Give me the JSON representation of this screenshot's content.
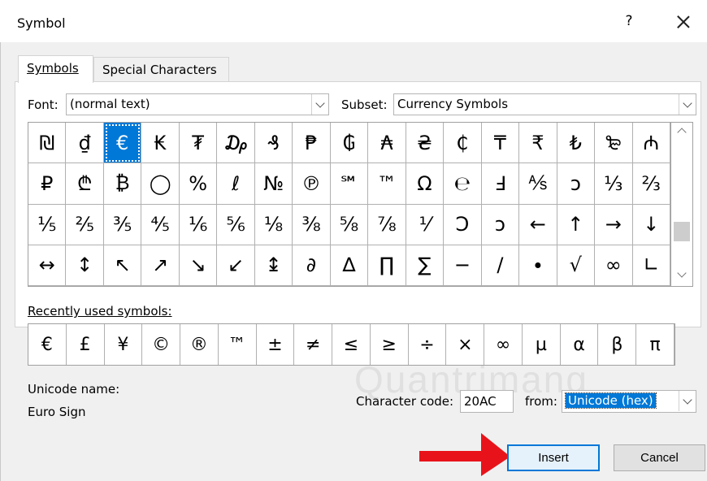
{
  "window": {
    "title": "Symbol",
    "help": "?"
  },
  "tabs": [
    {
      "label": "Symbols",
      "active": true
    },
    {
      "label": "Special Characters",
      "active": false
    }
  ],
  "font": {
    "label": "Font:",
    "value": "(normal text)"
  },
  "subset": {
    "label": "Subset:",
    "value": "Currency Symbols"
  },
  "symbols": [
    "₪",
    "₫",
    "€",
    "₭",
    "₮",
    "₯",
    "₰",
    "₱",
    "₲",
    "₳",
    "₴",
    "₵",
    "₸",
    "₹",
    "₺",
    "₻",
    "₼",
    "₽",
    "₾",
    "₿",
    "◯",
    "%",
    "ℓ",
    "№",
    "℗",
    "℠",
    "™",
    "Ω",
    "℮",
    "Ⅎ",
    "⅍",
    "ↄ",
    "⅓",
    "⅔",
    "⅕",
    "⅖",
    "⅗",
    "⅘",
    "⅙",
    "⅚",
    "⅛",
    "⅜",
    "⅝",
    "⅞",
    "⅟",
    "Ↄ",
    "ↄ",
    "←",
    "↑",
    "→",
    "↓",
    "↔",
    "↕",
    "↖",
    "↗",
    "↘",
    "↙",
    "↨",
    "∂",
    "∆",
    "∏",
    "∑",
    "−",
    "∕",
    "∙",
    "√",
    "∞",
    "∟"
  ],
  "selected_index": 2,
  "recent": {
    "label": "Recently used symbols:",
    "items": [
      "€",
      "£",
      "¥",
      "©",
      "®",
      "™",
      "±",
      "≠",
      "≤",
      "≥",
      "÷",
      "×",
      "∞",
      "µ",
      "α",
      "β",
      "π"
    ]
  },
  "unicode": {
    "label": "Unicode name:",
    "value": "Euro Sign"
  },
  "char_code": {
    "label": "Character code:",
    "value": "20AC"
  },
  "from": {
    "label": "from:",
    "value": "Unicode (hex)"
  },
  "buttons": {
    "insert": "Insert",
    "cancel": "Cancel"
  },
  "watermark": "Quantrimang",
  "colors": {
    "selection": "#0078d7",
    "arrow": "#e8131a"
  }
}
